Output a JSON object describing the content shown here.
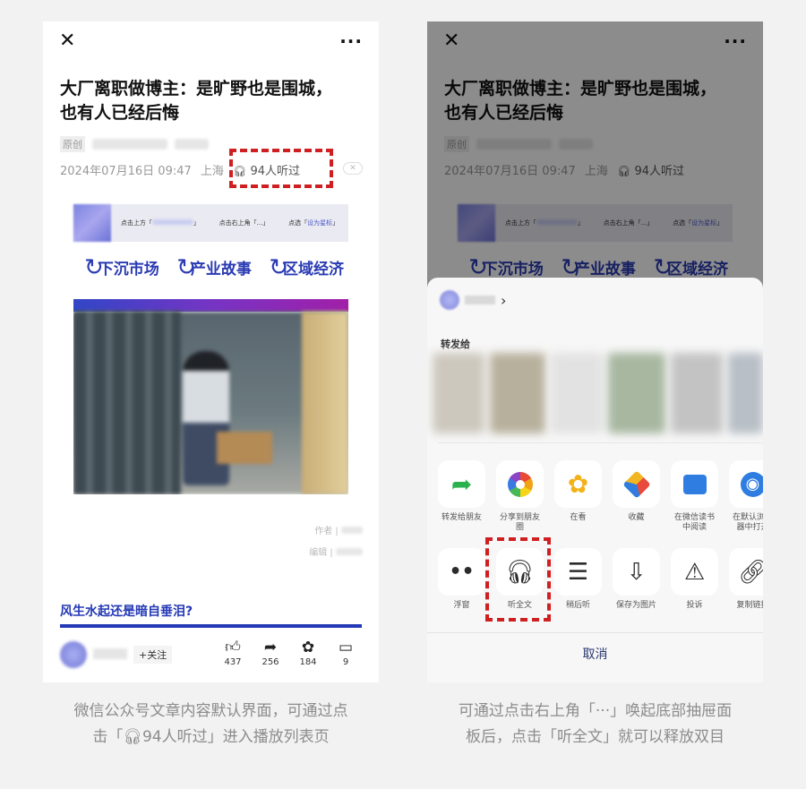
{
  "article": {
    "title_line1": "大厂离职做博主：是旷野也是围城，",
    "title_line2": "也有人已经后悔",
    "original_tag": "原创",
    "date": "2024年07月16日 09:47",
    "location": "上海",
    "listen_count": "94人听过",
    "banner": {
      "item1_prefix": "点击上方「",
      "item1_suffix": "」",
      "item2": "点击右上角「...」",
      "item3_prefix": "点选「",
      "item3_link": "设为星标",
      "item3_suffix": "」"
    },
    "categories": [
      "下沉市场",
      "产业故事",
      "区域经济"
    ],
    "author_line1": "作者 |",
    "author_line2": "编辑 |",
    "subheading": "风生水起还是暗自垂泪?",
    "follow_label": "+关注",
    "stats": {
      "likes": "437",
      "shares": "256",
      "wow": "184",
      "comments": "9"
    }
  },
  "sheet": {
    "forward_label": "转发给",
    "row1": [
      {
        "label": "转发给朋友",
        "icon": "share-arrow-icon"
      },
      {
        "label": "分享到朋友圈",
        "icon": "moments-icon"
      },
      {
        "label": "在看",
        "icon": "wow-icon"
      },
      {
        "label": "收藏",
        "icon": "favorite-cube-icon"
      },
      {
        "label": "在微信读书中阅读",
        "icon": "weread-icon"
      },
      {
        "label": "在默认浏览器中打开",
        "icon": "browser-icon"
      }
    ],
    "row2": [
      {
        "label": "浮窗",
        "icon": "float-window-icon"
      },
      {
        "label": "听全文",
        "icon": "headphones-icon"
      },
      {
        "label": "稍后听",
        "icon": "listen-later-icon"
      },
      {
        "label": "保存为图片",
        "icon": "save-image-icon"
      },
      {
        "label": "投诉",
        "icon": "warning-icon"
      },
      {
        "label": "复制链接",
        "icon": "link-icon"
      }
    ],
    "cancel_label": "取消"
  },
  "captions": {
    "left_line1": "微信公众号文章内容默认界面，可通过点",
    "left_line2_a": "击「",
    "left_line2_b": "94人听过」进入播放列表页",
    "right_line1": "可通过点击右上角「···」唤起底部抽屉面",
    "right_line2": "板后，点击「听全文」就可以释放双目"
  },
  "colors": {
    "highlight": "#cf1f20",
    "brand_blue": "#2439b6"
  }
}
